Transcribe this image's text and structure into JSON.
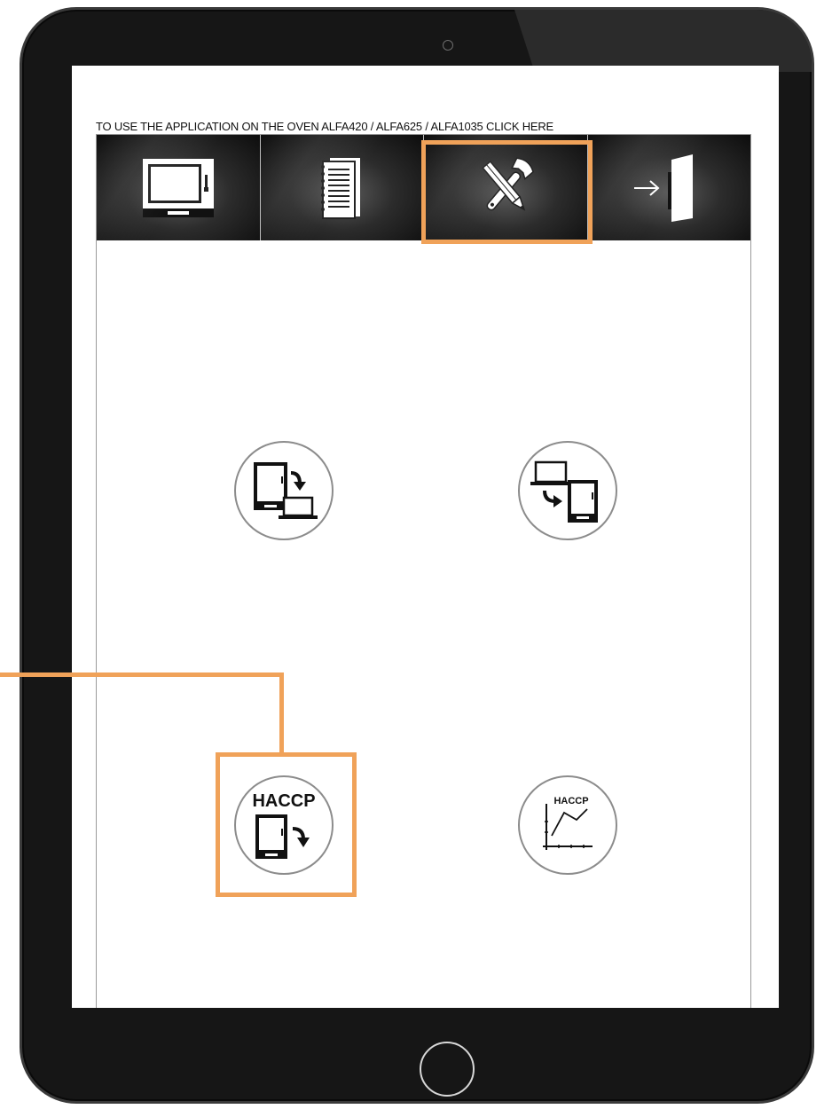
{
  "header": {
    "link_text": "TO USE THE APPLICATION ON THE OVEN ALFA420 / ALFA625 / ALFA1035 CLICK HERE"
  },
  "toolbar": {
    "tabs": [
      {
        "id": "oven",
        "icon": "oven-icon"
      },
      {
        "id": "recipes",
        "icon": "notebook-icon"
      },
      {
        "id": "settings",
        "icon": "tools-icon",
        "selected": true
      },
      {
        "id": "exit",
        "icon": "exit-door-icon"
      }
    ]
  },
  "actions": [
    {
      "id": "export-to-computer",
      "icon": "tablet-to-laptop-icon"
    },
    {
      "id": "import-from-computer",
      "icon": "laptop-to-tablet-icon"
    },
    {
      "id": "haccp-download",
      "icon": "haccp-download-icon",
      "label": "HACCP",
      "highlighted": true
    },
    {
      "id": "haccp-chart",
      "icon": "haccp-chart-icon",
      "label": "HACCP"
    }
  ],
  "colors": {
    "highlight": "#f0a259",
    "device_frame": "#161616",
    "toolbar_dark": "#0d0d0d"
  }
}
